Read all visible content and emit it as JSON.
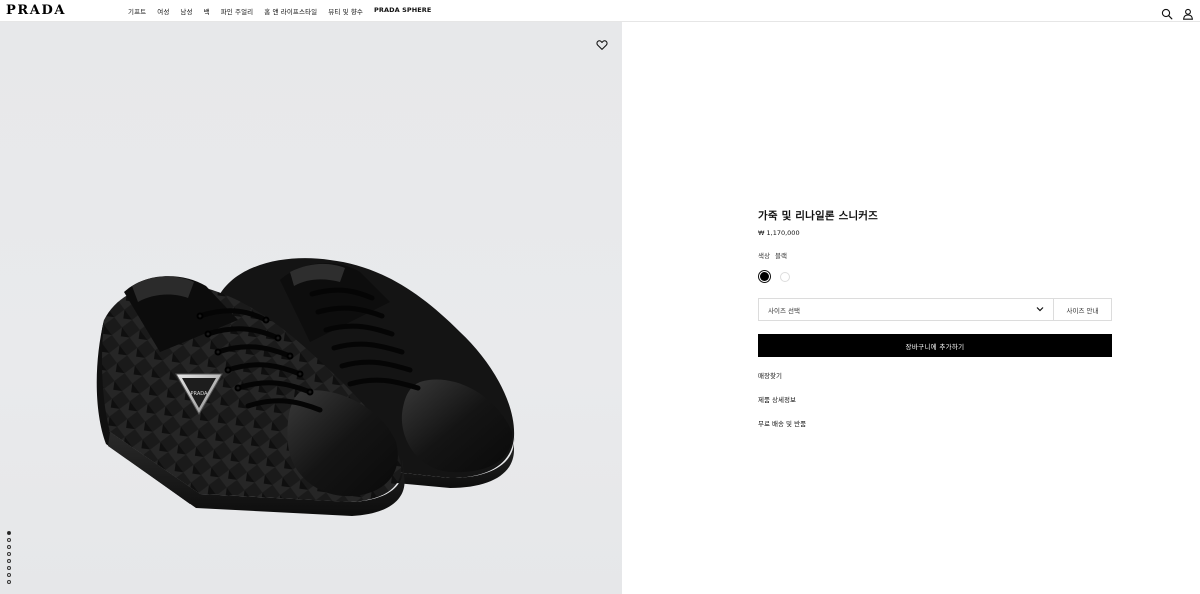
{
  "header": {
    "logo": "PRADA",
    "nav": [
      {
        "label": "기프트"
      },
      {
        "label": "여성"
      },
      {
        "label": "남성"
      },
      {
        "label": "백"
      },
      {
        "label": "파인 주얼리"
      },
      {
        "label": "홈 앤 라이프스타일"
      },
      {
        "label": "뷰티 및 향수"
      },
      {
        "label": "PRADA SPHERE"
      }
    ],
    "icons": [
      "search-icon",
      "account-icon"
    ]
  },
  "gallery": {
    "background_color": "#e8e9eb",
    "image_count": 8,
    "active_index": 0,
    "wishlist_icon": "heart-icon"
  },
  "product": {
    "title": "가죽 및 리나일론 스니커즈",
    "price": "₩ 1,170,000",
    "color_label": "색상",
    "color_value": "블랙",
    "swatches": [
      {
        "color": "#000000",
        "selected": true
      },
      {
        "color": "#ffffff",
        "selected": false
      }
    ],
    "size_select_label": "사이즈 선택",
    "size_guide_label": "사이즈 안내",
    "add_to_cart_label": "장바구니에 추가하기",
    "links": [
      {
        "label": "매장찾기"
      },
      {
        "label": "제품 상세정보"
      },
      {
        "label": "무료 배송 및 반품"
      }
    ]
  }
}
